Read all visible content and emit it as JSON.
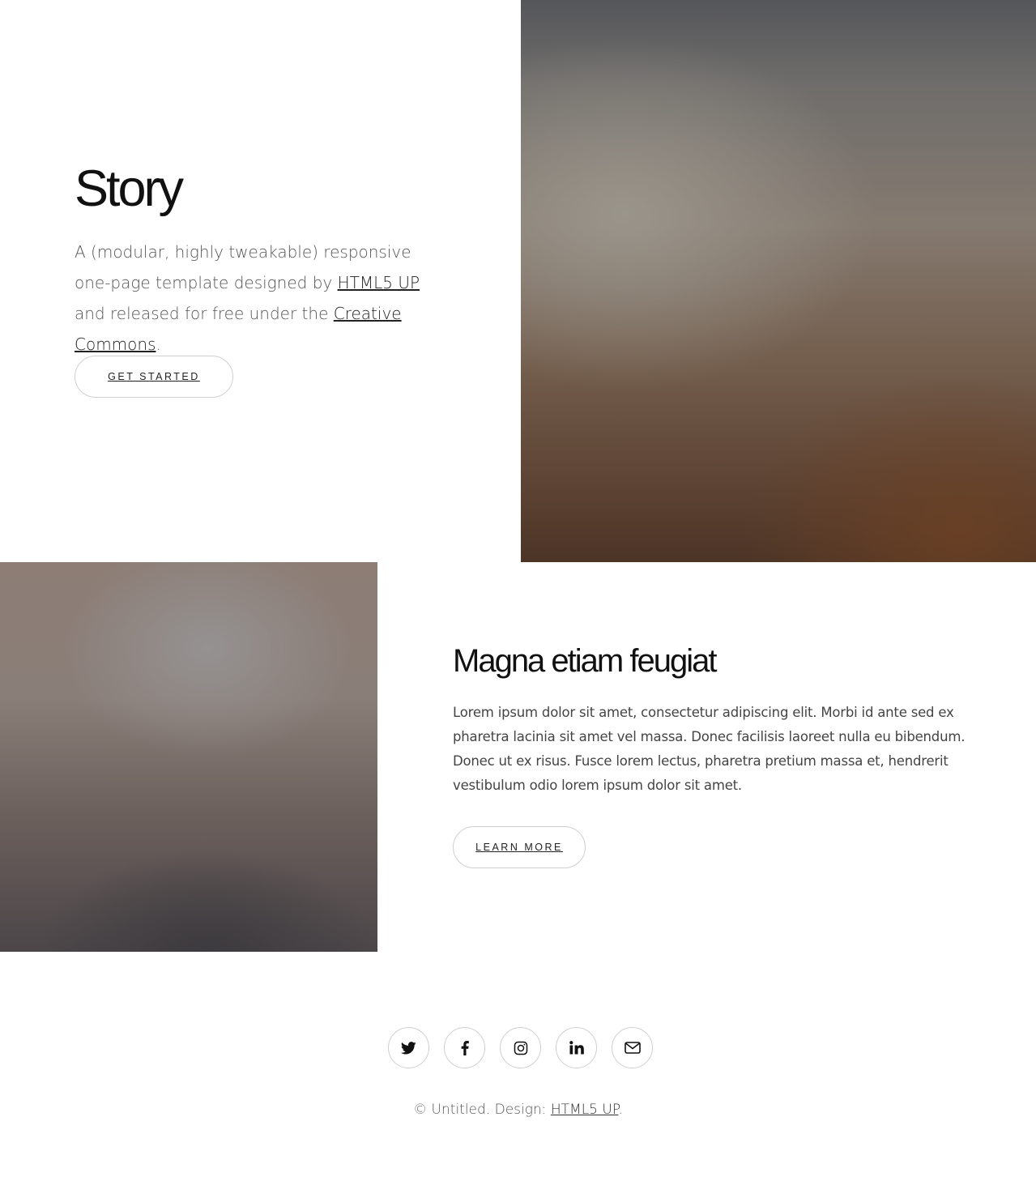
{
  "banner": {
    "title": "Story",
    "text_before": "A (modular, highly tweakable) responsive one-page template designed by ",
    "link1": "HTML5 UP",
    "text_middle": " and released for free under the ",
    "link2": "Creative Commons",
    "text_after": ".",
    "button_label": "Get Started"
  },
  "spotlight": {
    "title": "Magna etiam feugiat",
    "text": "Lorem ipsum dolor sit amet, consectetur adipiscing elit. Morbi id ante sed ex pharetra lacinia sit amet vel massa. Donec facilisis laoreet nulla eu bibendum. Donec ut ex risus. Fusce lorem lectus, pharetra pretium massa et, hendrerit vestibulum odio lorem ipsum dolor sit amet.",
    "button_label": "Learn More"
  },
  "footer": {
    "social_icons": [
      "twitter-icon",
      "facebook-icon",
      "instagram-icon",
      "linkedin-icon",
      "envelope-icon"
    ],
    "copyright_prefix": "© Untitled. Design: ",
    "copyright_link": "HTML5 UP",
    "copyright_suffix": "."
  }
}
